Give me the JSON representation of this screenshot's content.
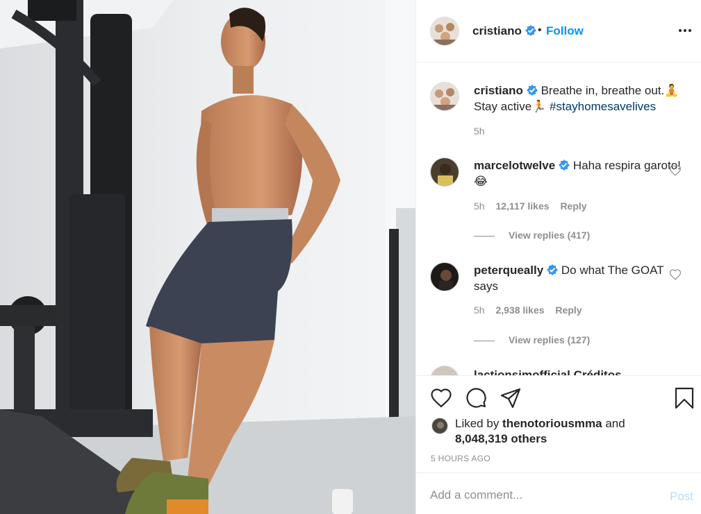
{
  "post": {
    "author": "cristiano",
    "dot": "•",
    "follow_label": "Follow",
    "caption_text": "Breathe in, breathe out.🧘 Stay active🏃 ",
    "caption_hashtag": "#stayhomesavelives",
    "caption_time": "5h"
  },
  "comments": [
    {
      "user": "marcelotwelve",
      "text": "Haha respira garoto! 😂",
      "time": "5h",
      "likes": "12,117 likes",
      "reply_label": "Reply",
      "view_replies": "View replies (417)"
    },
    {
      "user": "peterqueally",
      "text": "Do what The GOAT says",
      "time": "5h",
      "likes": "2,938 likes",
      "reply_label": "Reply",
      "view_replies": "View replies (127)"
    }
  ],
  "partial_comment": {
    "text": "lactionsimofficial Créditos"
  },
  "likes_summary": {
    "prefix": "Liked by ",
    "liker": "thenotoriousmma",
    "middle": " and",
    "count": "8,048,319 others"
  },
  "timestamp": "5 HOURS AGO",
  "comment_box": {
    "placeholder": "Add a comment...",
    "post_label": "Post"
  },
  "icons": {
    "verified": "verified-badge-icon",
    "more": "more-options-icon",
    "heart": "heart-icon",
    "comment": "comment-icon",
    "share": "share-icon",
    "save": "bookmark-icon"
  },
  "colors": {
    "link_blue": "#0095f6",
    "hashtag": "#00376b",
    "muted": "#8e8e8e",
    "post_disabled": "#b2dffc"
  }
}
